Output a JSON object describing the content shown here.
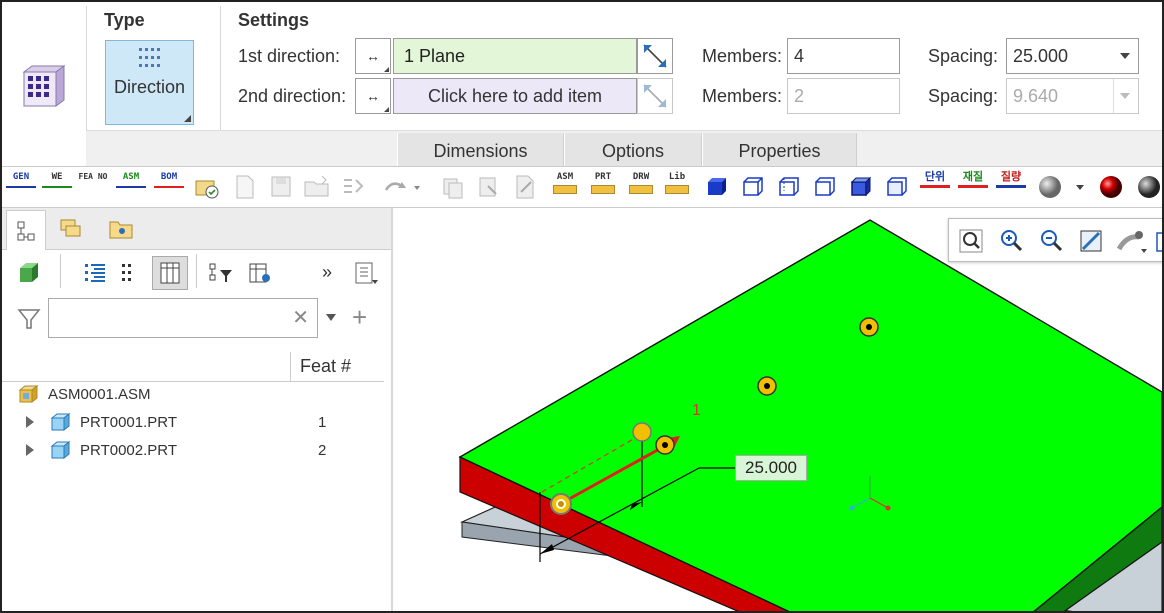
{
  "dashboard": {
    "type_group_title": "Type",
    "settings_group_title": "Settings",
    "direction_button_label": "Direction",
    "row1": {
      "label": "1st direction:",
      "collector_value": "1 Plane",
      "members_label": "Members:",
      "members_value": "4",
      "spacing_label": "Spacing:",
      "spacing_value": "25.000"
    },
    "row2": {
      "label": "2nd direction:",
      "collector_placeholder": "Click here to add item",
      "members_label": "Members:",
      "members_value": "2",
      "spacing_label": "Spacing:",
      "spacing_value": "9.640"
    },
    "tabs": [
      "Dimensions",
      "Options",
      "Properties"
    ]
  },
  "toolbar": {
    "text_icons": [
      "GEN",
      "WE",
      "FEA NO",
      "ASM",
      "BOM",
      "ASM",
      "PRT",
      "DRW",
      "Lib",
      "단위",
      "재질",
      "질량"
    ]
  },
  "model_tree": {
    "column_header": "Feat #",
    "search_value": "",
    "items": [
      {
        "name": "ASM0001.ASM",
        "feat": ""
      },
      {
        "name": "PRT0001.PRT",
        "feat": "1"
      },
      {
        "name": "PRT0002.PRT",
        "feat": "2"
      }
    ]
  },
  "graphics": {
    "dimension_value": "25.000",
    "member_label": "1"
  },
  "colors": {
    "top_face": "#00ff00",
    "side_face_red": "#cc0000",
    "side_face_green": "#0f7a0f",
    "bottom_plate": "#c8d0d8",
    "collector_active": "#e3f6d8",
    "collector_empty": "#ece8f7",
    "direction_button": "#cfe8f8"
  }
}
